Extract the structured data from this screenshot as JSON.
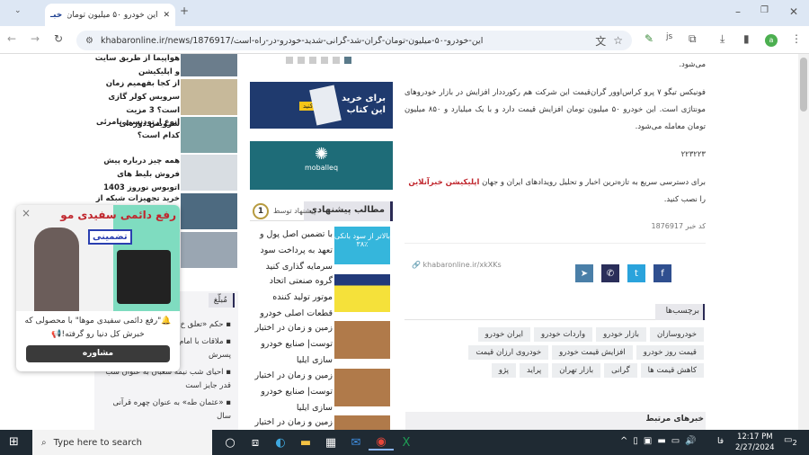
{
  "browser": {
    "tab_title": "این خودرو ۵۰ میلیون تومان گران ش",
    "url": "khabaronline.ir/news/1876917/این-خودرو-۵۰-میلیون-تومان-گران-شد-گرانی-شدید-خودرو-در-راه-است",
    "new_tab": "+",
    "minimize": "–",
    "maximize": "❐",
    "close": "✕",
    "avatar": "a"
  },
  "left_news": [
    {
      "title": "هواپیما از طریق سایت و اپلیکیشن"
    },
    {
      "title": "از کجا بفهمیم زمان سرویس کولر گازی است؟ 3 مزیت سرویس دوره‌ای"
    },
    {
      "title": "انوع ارتودنسی نامرئی کدام است؟"
    },
    {
      "title": "همه چیز درباره پیش فروش بلیط های اتوبوس نوروز 1403"
    },
    {
      "title": "خرید تجهیزات شبکه از"
    }
  ],
  "popup_ad": {
    "headline1": "رفع دائمی",
    "headline2": "سفیدی مو",
    "badge": "تضمینی",
    "text": "🔔\"رفع دائمی سفیدی موها\" با محصولی که خبرش کل دنیا رو گرفته!📢",
    "button": "مشاوره",
    "close": "×"
  },
  "left_section": {
    "tab": "مُبلّغ",
    "items": [
      "حکم «تعلق خ... چیست؟",
      "ملاقات با امام ناگفته‌هایی از زبان پسرش",
      "احیای شب نیمه شعبان به عنوان شب قدر جایز است",
      "«عثمان طه» به عنوان چهره قرآنی سال"
    ]
  },
  "middle": {
    "ad1_line1": "برای خرید",
    "ad1_line2": "این کتاب",
    "ad1_btn": "کلیک کنید",
    "ad2_brand": "moballeq",
    "suggested_title": "مطالب پیشنهادی",
    "suggested_by": "پیشنهاد توسط",
    "items": [
      {
        "title": "با تضمین اصل پول و تعهد به پرداخت سود سرمایه گذاری کنید",
        "img_text": "بالاتر از سود بانکی ۳۸٪"
      },
      {
        "title": "گروه صنعتی اتحاد موتور تولید کننده قطعات اصلی خودرو"
      },
      {
        "title": "زمین و زمان در اختیار توست| صنایع خودرو سازی ایلیا"
      },
      {
        "title": "زمین و زمان در اختیار توست| صنایع خودرو سازی ایلیا"
      },
      {
        "title": "زمین و زمان در اختیار"
      }
    ]
  },
  "article": {
    "p0": "می‌شود.",
    "p1": "فونیکس تیگو ۷ پرو کراس‌اوور گران‌قیمت این شرکت هم رکورددار افزایش در بازار خودروهای مونتاژی است. این خودرو ۵۰ میلیون تومان افزایش قیمت دارد و با یک میلیارد و ۸۵۰ میلیون تومان معامله می‌شود.",
    "p2": "۲۲۳۲۲۳",
    "p3_before": "برای دسترسی سریع به تازه‌ترین اخبار و تحلیل رویدادهای ایران و جهان ",
    "p3_link": "اپلیکیشن خبرآنلاین",
    "p3_after": " را نصب کنید.",
    "code_label": "کد خبر",
    "code": "1876917",
    "short_link": "khabaronline.ir/xkXKs",
    "tags_title": "برچسب‌ها",
    "tags": [
      "خودروسازان",
      "بازار خودرو",
      "واردات خودرو",
      "ایران خودرو",
      "قیمت روز خودرو",
      "افزایش قیمت خودرو",
      "خودروی ارزان قیمت",
      "کاهش قیمت ها",
      "گرانی",
      "بازار تهران",
      "پراید",
      "پژو"
    ],
    "related_title": "خبرهای مرتبط",
    "link_color": "#c0262d"
  },
  "taskbar": {
    "search_placeholder": "Type here to search",
    "time": "12:17 PM",
    "date": "2/27/2024",
    "lang": "فا",
    "notifications": "2"
  }
}
